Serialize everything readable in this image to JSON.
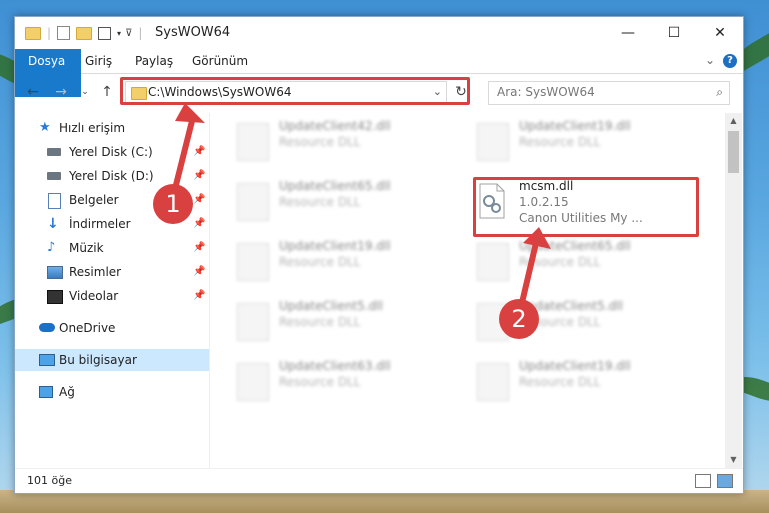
{
  "window": {
    "title": "SysWOW64"
  },
  "ribbon": {
    "tabs": [
      "Dosya",
      "Giriş",
      "Paylaş",
      "Görünüm"
    ],
    "help": "?"
  },
  "navigation": {
    "address": "C:\\Windows\\SysWOW64",
    "search_placeholder": "Ara: SysWOW64"
  },
  "sidebar": {
    "items": [
      {
        "label": "Hızlı erişim",
        "icon": "star-icon"
      },
      {
        "label": "Yerel Disk (C:)",
        "icon": "drive-icon",
        "pinned": true
      },
      {
        "label": "Yerel Disk (D:)",
        "icon": "drive-icon",
        "pinned": true
      },
      {
        "label": "Belgeler",
        "icon": "documents-icon",
        "pinned": true
      },
      {
        "label": "İndirmeler",
        "icon": "download-icon",
        "pinned": true
      },
      {
        "label": "Müzik",
        "icon": "music-icon",
        "pinned": true
      },
      {
        "label": "Resimler",
        "icon": "pictures-icon",
        "pinned": true
      },
      {
        "label": "Videolar",
        "icon": "videos-icon",
        "pinned": true
      },
      {
        "label": "OneDrive",
        "icon": "cloud-icon"
      },
      {
        "label": "Bu bilgisayar",
        "icon": "computer-icon",
        "selected": true
      },
      {
        "label": "Ağ",
        "icon": "network-icon"
      }
    ]
  },
  "files": [
    {
      "name": "UpdateClient42.dll",
      "desc": "Resource DLL"
    },
    {
      "name": "UpdateClient19.dll",
      "desc": "Resource DLL"
    },
    {
      "name": "UpdateClient65.dll",
      "desc": "Resource DLL"
    },
    {
      "name": "mcsm.dll",
      "version": "1.0.2.15",
      "company": "Canon Utilities My ...",
      "highlighted": true
    },
    {
      "name": "UpdateClient19.dll",
      "desc": "Resource DLL"
    },
    {
      "name": "UpdateClient65.dll",
      "desc": "Resource DLL"
    },
    {
      "name": "UpdateClient5.dll",
      "desc": "Resource DLL"
    },
    {
      "name": "UpdateClient5.dll",
      "desc": "Resource DLL"
    },
    {
      "name": "UpdateClient63.dll",
      "desc": "Resource DLL"
    },
    {
      "name": "UpdateClient19.dll",
      "desc": "Resource DLL"
    }
  ],
  "status": {
    "item_count": "101 öğe"
  },
  "annotations": {
    "step1": "1",
    "step2": "2",
    "color": "#d94040"
  },
  "colors": {
    "file_tab": "#1979ca",
    "selected": "#cce8ff"
  }
}
